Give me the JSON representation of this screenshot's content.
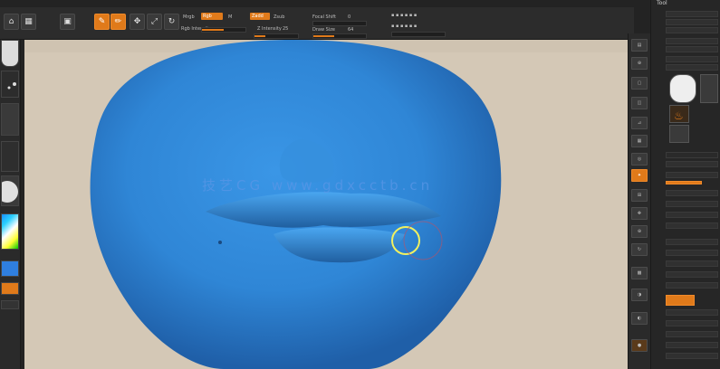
{
  "app": {
    "title": "Tool"
  },
  "toolbar": {
    "draw_label": "Draw",
    "move_label": "Move",
    "scale_label": "Scale",
    "rotate_label": "Rotate",
    "mrgb_label": "Mrgb",
    "rgb_label": "Rgb",
    "m_label": "M",
    "zadd_label": "Zadd",
    "zsub_label": "Zsub",
    "focal_label": "Focal Shift",
    "focal_value": "0",
    "draw_size_label": "Draw Size",
    "draw_size_value": "64",
    "z_intensity_label": "Z Intensity",
    "z_intensity_value": "25",
    "z_intensity_level": 0.25,
    "draw_size_level": 0.4,
    "rgb_intensity_level": 0.5
  },
  "canvas": {
    "watermark": "技艺CG  www.gdxcctb.cn"
  },
  "brush_cursor": {
    "color": "#f0f060"
  },
  "colors": {
    "accent": "#e07a1a",
    "model_blue": "#2f86d6",
    "canvas_bg": "#d4c8b6"
  }
}
